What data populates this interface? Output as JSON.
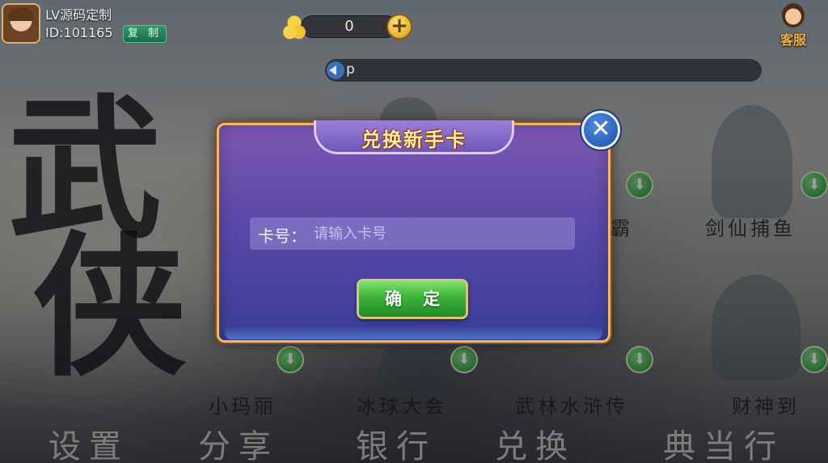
{
  "user": {
    "name": "LV源码定制",
    "id": "ID:101165",
    "copy_label": "复 制"
  },
  "wallet": {
    "gold": "0",
    "add_symbol": "+"
  },
  "service": {
    "label": "客服"
  },
  "notice": {
    "text": "p"
  },
  "background": {
    "calligraphy": [
      "武",
      "侠"
    ],
    "game_labels": [
      "霸",
      "剑仙捕鱼",
      "小玛丽",
      "冰球大会",
      "武林水浒传",
      "财神到"
    ],
    "nav_labels": [
      "设置",
      "分享",
      "银行",
      "兑换",
      "典当行"
    ]
  },
  "dialog": {
    "title": "兑换新手卡",
    "close_symbol": "✕",
    "card_label": "卡号：",
    "card_placeholder": "请输入卡号",
    "card_value": "",
    "confirm_label": "确定"
  }
}
